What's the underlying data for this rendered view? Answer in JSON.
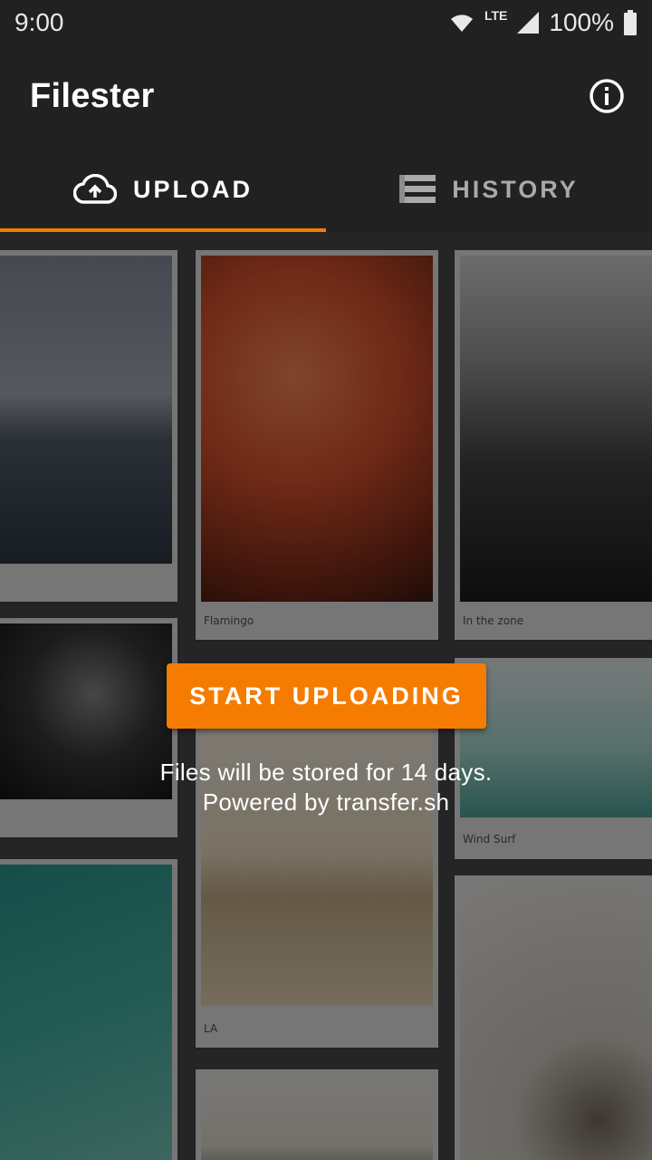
{
  "status_bar": {
    "time": "9:00",
    "network": "LTE",
    "battery": "100%"
  },
  "app_bar": {
    "title": "Filester"
  },
  "tabs": [
    {
      "label": "UPLOAD",
      "icon": "cloud-upload-icon",
      "active": true
    },
    {
      "label": "HISTORY",
      "icon": "list-icon",
      "active": false
    }
  ],
  "gallery": {
    "captions": [
      "Flamingo",
      "In the zone",
      "Wind Surf",
      "LA"
    ]
  },
  "main": {
    "button_label": "START UPLOADING",
    "info_line1": "Files will be stored for 14 days.",
    "info_line2": "Powered by transfer.sh"
  },
  "colors": {
    "accent": "#f57c00",
    "appbar": "#212121"
  }
}
